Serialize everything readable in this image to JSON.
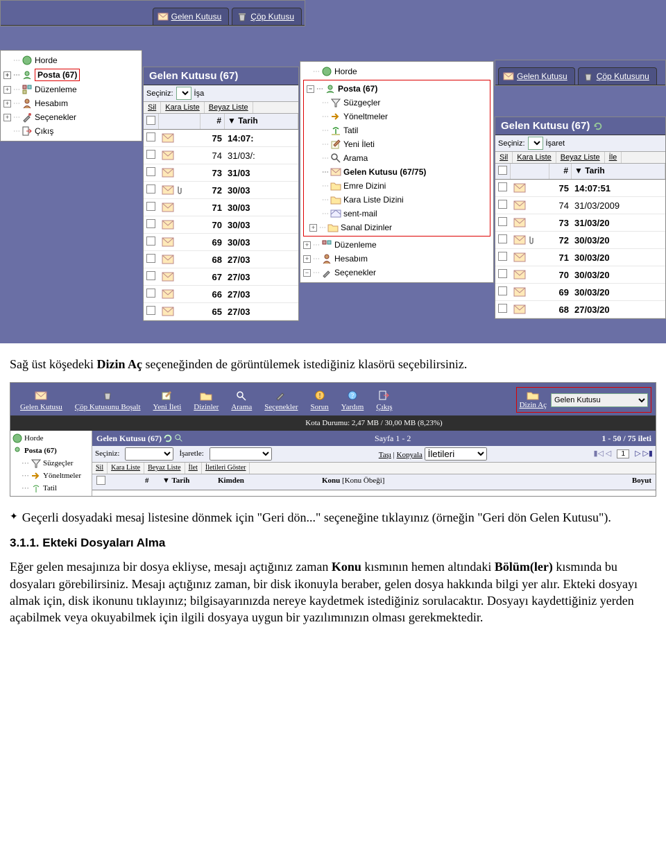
{
  "tabs": {
    "inbox": "Gelen Kutusu",
    "trash": "Çöp Kutusu",
    "trash_long": "Çöp Kutusunu"
  },
  "tree_left": {
    "horde": "Horde",
    "posta": "Posta (67)",
    "duzenleme": "Düzenleme",
    "hesabim": "Hesabım",
    "secenekler": "Seçenekler",
    "cikis": "Çıkış"
  },
  "tree_center": {
    "horde": "Horde",
    "posta": "Posta (67)",
    "suzgecler": "Süzgeçler",
    "yoneltmeler": "Yöneltmeler",
    "tatil": "Tatil",
    "yeni_ileti": "Yeni İleti",
    "arama": "Arama",
    "gelen_kutusu": "Gelen Kutusu (67/75)",
    "emre_dizini": "Emre Dizini",
    "kara_liste_dizini": "Kara Liste Dizini",
    "sent_mail": "sent-mail",
    "sanal_dizinler": "Sanal Dizinler",
    "duzenleme": "Düzenleme",
    "hesabim": "Hesabım",
    "secenekler": "Seçenekler"
  },
  "inbox": {
    "title": "Gelen Kutusu (67)",
    "seciniz_label": "Seçiniz:",
    "isaretle_prefix": "İşa",
    "isaretle_full": "İşaret",
    "ile": "İle",
    "buttons": {
      "sil": "Sil",
      "kara": "Kara Liste",
      "beyaz": "Beyaz Liste"
    },
    "cols": {
      "num": "#",
      "date": "Tarih"
    },
    "rows_left": [
      {
        "n": "75",
        "d": "14:07:",
        "bold": true,
        "attach": false
      },
      {
        "n": "74",
        "d": "31/03/:",
        "bold": false,
        "attach": false
      },
      {
        "n": "73",
        "d": "31/03",
        "bold": true,
        "attach": false
      },
      {
        "n": "72",
        "d": "30/03",
        "bold": true,
        "attach": true
      },
      {
        "n": "71",
        "d": "30/03",
        "bold": true,
        "attach": false
      },
      {
        "n": "70",
        "d": "30/03",
        "bold": true,
        "attach": false
      },
      {
        "n": "69",
        "d": "30/03",
        "bold": true,
        "attach": false
      },
      {
        "n": "68",
        "d": "27/03",
        "bold": true,
        "attach": false
      },
      {
        "n": "67",
        "d": "27/03",
        "bold": true,
        "attach": false
      },
      {
        "n": "66",
        "d": "27/03",
        "bold": true,
        "attach": false
      },
      {
        "n": "65",
        "d": "27/03",
        "bold": true,
        "attach": false
      }
    ],
    "rows_right": [
      {
        "n": "75",
        "d": "14:07:51",
        "bold": true,
        "attach": false
      },
      {
        "n": "74",
        "d": "31/03/2009",
        "bold": false,
        "attach": false
      },
      {
        "n": "73",
        "d": "31/03/20",
        "bold": true,
        "attach": false
      },
      {
        "n": "72",
        "d": "30/03/20",
        "bold": true,
        "attach": true
      },
      {
        "n": "71",
        "d": "30/03/20",
        "bold": true,
        "attach": false
      },
      {
        "n": "70",
        "d": "30/03/20",
        "bold": true,
        "attach": false
      },
      {
        "n": "69",
        "d": "30/03/20",
        "bold": true,
        "attach": false
      },
      {
        "n": "68",
        "d": "27/03/20",
        "bold": true,
        "attach": false
      }
    ]
  },
  "wide": {
    "menu": {
      "gelen": "Gelen Kutusu",
      "bosalt": "Çöp Kutusunu Boşalt",
      "yeni": "Yeni İleti",
      "dizinler": "Dizinler",
      "arama": "Arama",
      "secenekler": "Seçenekler",
      "sorun": "Sorun",
      "yardim": "Yardım",
      "cikis": "Çıkış",
      "dizin_ac": "Dizin Aç",
      "dizin_sel": "Gelen Kutusu"
    },
    "quota": "Kota Durumu: 2,47 MB / 30,00 MB (8,23%)",
    "left": {
      "horde": "Horde",
      "posta": "Posta (67)",
      "suzgecler": "Süzgeçler",
      "yoneltmeler": "Yöneltmeler",
      "tatil": "Tatil"
    },
    "hdr_title": "Gelen Kutusu (67)",
    "hdr_pages": "Sayfa 1 - 2",
    "hdr_count": "1 - 50 / 75 ileti",
    "ctrl": {
      "seciniz": "Seçiniz:",
      "isaretle": "İşaretle:",
      "tasi": "Taşı",
      "kopyala": "Kopyala",
      "iletileri": "İletileri",
      "page": "1"
    },
    "btns": {
      "sil": "Sil",
      "kara": "Kara Liste",
      "beyaz": "Beyaz Liste",
      "ilet": "İlet",
      "goster": "İletileri Göster"
    },
    "cols": {
      "num": "#",
      "tarih": "Tarih",
      "kimden": "Kimden",
      "konu": "Konu",
      "konu2": "[Konu Öbeği]",
      "boyut": "Boyut"
    }
  },
  "doc": {
    "p1a": "Sağ üst köşedeki ",
    "p1b": "Dizin Aç",
    "p1c": " seçeneğinden de görüntülemek istediğiniz klasörü seçebilirsiniz.",
    "p2": "Geçerli dosyadaki mesaj listesine dönmek için \"Geri dön...\" seçeneğine tıklayınız (örneğin \"Geri dön Gelen Kutusu\").",
    "h3": "3.1.1. Ekteki Dosyaları Alma",
    "p3a": "Eğer gelen mesajınıza bir dosya ekliyse, mesajı açtığınız zaman ",
    "p3b": "Konu",
    "p3c": " kısmının hemen altındaki ",
    "p3d": "Bölüm(ler)",
    "p3e": " kısmında bu dosyaları görebilirsiniz. Mesajı açtığınız zaman, bir disk ikonuyla beraber, gelen dosya hakkında bilgi yer alır. Ekteki dosyayı almak için, disk ikonunu tıklayınız; bilgisayarınızda nereye kaydetmek istediğiniz sorulacaktır. Dosyayı kaydettiğiniz yerden açabilmek veya okuyabilmek için ilgili dosyaya uygun bir yazılımınızın olması gerekmektedir."
  }
}
